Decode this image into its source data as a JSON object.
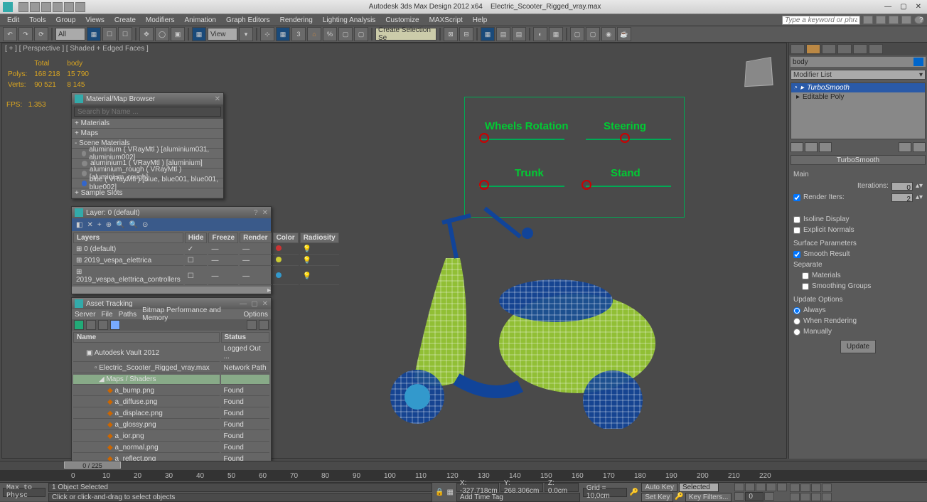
{
  "app": {
    "title": "Autodesk 3ds Max Design 2012 x64",
    "file": "Electric_Scooter_Rigged_vray.max",
    "search_placeholder": "Type a keyword or phrase"
  },
  "menus": [
    "Edit",
    "Tools",
    "Group",
    "Views",
    "Create",
    "Modifiers",
    "Animation",
    "Graph Editors",
    "Rendering",
    "Lighting Analysis",
    "Customize",
    "MAXScript",
    "Help"
  ],
  "toolbar": {
    "selset": "All",
    "view": "View",
    "create_set": "Create Selection Se"
  },
  "viewport": {
    "label": "[ + ] [ Perspective ] [ Shaded + Edged Faces ]",
    "stats": {
      "hdr_total": "Total",
      "hdr_body": "body",
      "polys_lbl": "Polys:",
      "polys_total": "168 218",
      "polys_body": "15 790",
      "verts_lbl": "Verts:",
      "verts_total": "90 521",
      "verts_body": "8 145",
      "fps_lbl": "FPS:",
      "fps": "1.353"
    },
    "hud": {
      "wheels": "Wheels Rotation",
      "steering": "Steering",
      "trunk": "Trunk",
      "stand": "Stand"
    }
  },
  "matbrowser": {
    "title": "Material/Map Browser",
    "search": "Search by Name ...",
    "groups": [
      "+ Materials",
      "+ Maps",
      "- Scene Materials"
    ],
    "mats": [
      "aluminium  ( VRayMtl )  [aluminium031, aluminium002]",
      "aluminium1  ( VRayMtl )  [aluminium]",
      "aluminium_rough  ( VRayMtl )  [aluminium_rough]",
      "blue  ( VRayMtl )  [blue, blue001, blue001, blue002]"
    ],
    "slots": "+ Sample Slots"
  },
  "layers": {
    "title": "Layer: 0 (default)",
    "cols": [
      "Layers",
      "Hide",
      "Freeze",
      "Render",
      "Color",
      "Radiosity"
    ],
    "rows": [
      {
        "name": "0 (default)",
        "check": true,
        "color": "#c33"
      },
      {
        "name": "2019_vespa_elettrica",
        "check": false,
        "color": "#cc3"
      },
      {
        "name": "2019_vespa_elettrica_controllers",
        "check": false,
        "color": "#39c"
      }
    ]
  },
  "assets": {
    "title": "Asset Tracking",
    "menu": [
      "Server",
      "File",
      "Paths",
      "Bitmap Performance and Memory",
      "Options"
    ],
    "cols": [
      "Name",
      "Status"
    ],
    "rows": [
      {
        "n": "Autodesk Vault 2012",
        "s": "Logged Out ..."
      },
      {
        "n": "Electric_Scooter_Rigged_vray.max",
        "s": "Network Path"
      },
      {
        "n": "Maps / Shaders",
        "s": ""
      },
      {
        "n": "a_bump.png",
        "s": "Found"
      },
      {
        "n": "a_diffuse.png",
        "s": "Found"
      },
      {
        "n": "a_displace.png",
        "s": "Found"
      },
      {
        "n": "a_glossy.png",
        "s": "Found"
      },
      {
        "n": "a_ior.png",
        "s": "Found"
      },
      {
        "n": "a_normal.png",
        "s": "Found"
      },
      {
        "n": "a_reflect.png",
        "s": "Found"
      }
    ]
  },
  "cmd": {
    "obj": "body",
    "modlist": "Modifier List",
    "stack": [
      "TurboSmooth",
      "Editable Poly"
    ],
    "roll": "TurboSmooth",
    "main": "Main",
    "iter_lbl": "Iterations:",
    "iter": "0",
    "rend_lbl": "Render Iters:",
    "rend": "2",
    "rend_chk": true,
    "isoline": "Isoline Display",
    "explicit": "Explicit Normals",
    "surf": "Surface Parameters",
    "smooth": "Smooth Result",
    "smooth_chk": true,
    "sep": "Separate",
    "sep_mat": "Materials",
    "sep_grp": "Smoothing Groups",
    "upd": "Update Options",
    "always": "Always",
    "render": "When Rendering",
    "manual": "Manually",
    "updbtn": "Update"
  },
  "time": {
    "pos": "0 / 225",
    "ticks": [
      0,
      10,
      20,
      30,
      40,
      50,
      60,
      70,
      80,
      90,
      100,
      110,
      120,
      130,
      140,
      150,
      160,
      170,
      180,
      190,
      200,
      210,
      220
    ]
  },
  "status": {
    "script": "Max to Physc",
    "sel": "1 Object Selected",
    "prompt": "Click or click-and-drag to select objects",
    "x": "X: -327,718cm",
    "y": "Y: 268,306cm",
    "z": "Z: 0,0cm",
    "grid": "Grid = 10,0cm",
    "autokey": "Auto Key",
    "setkey": "Set Key",
    "selected": "Selected",
    "keyfilt": "Key Filters...",
    "tag": "Add Time Tag"
  }
}
